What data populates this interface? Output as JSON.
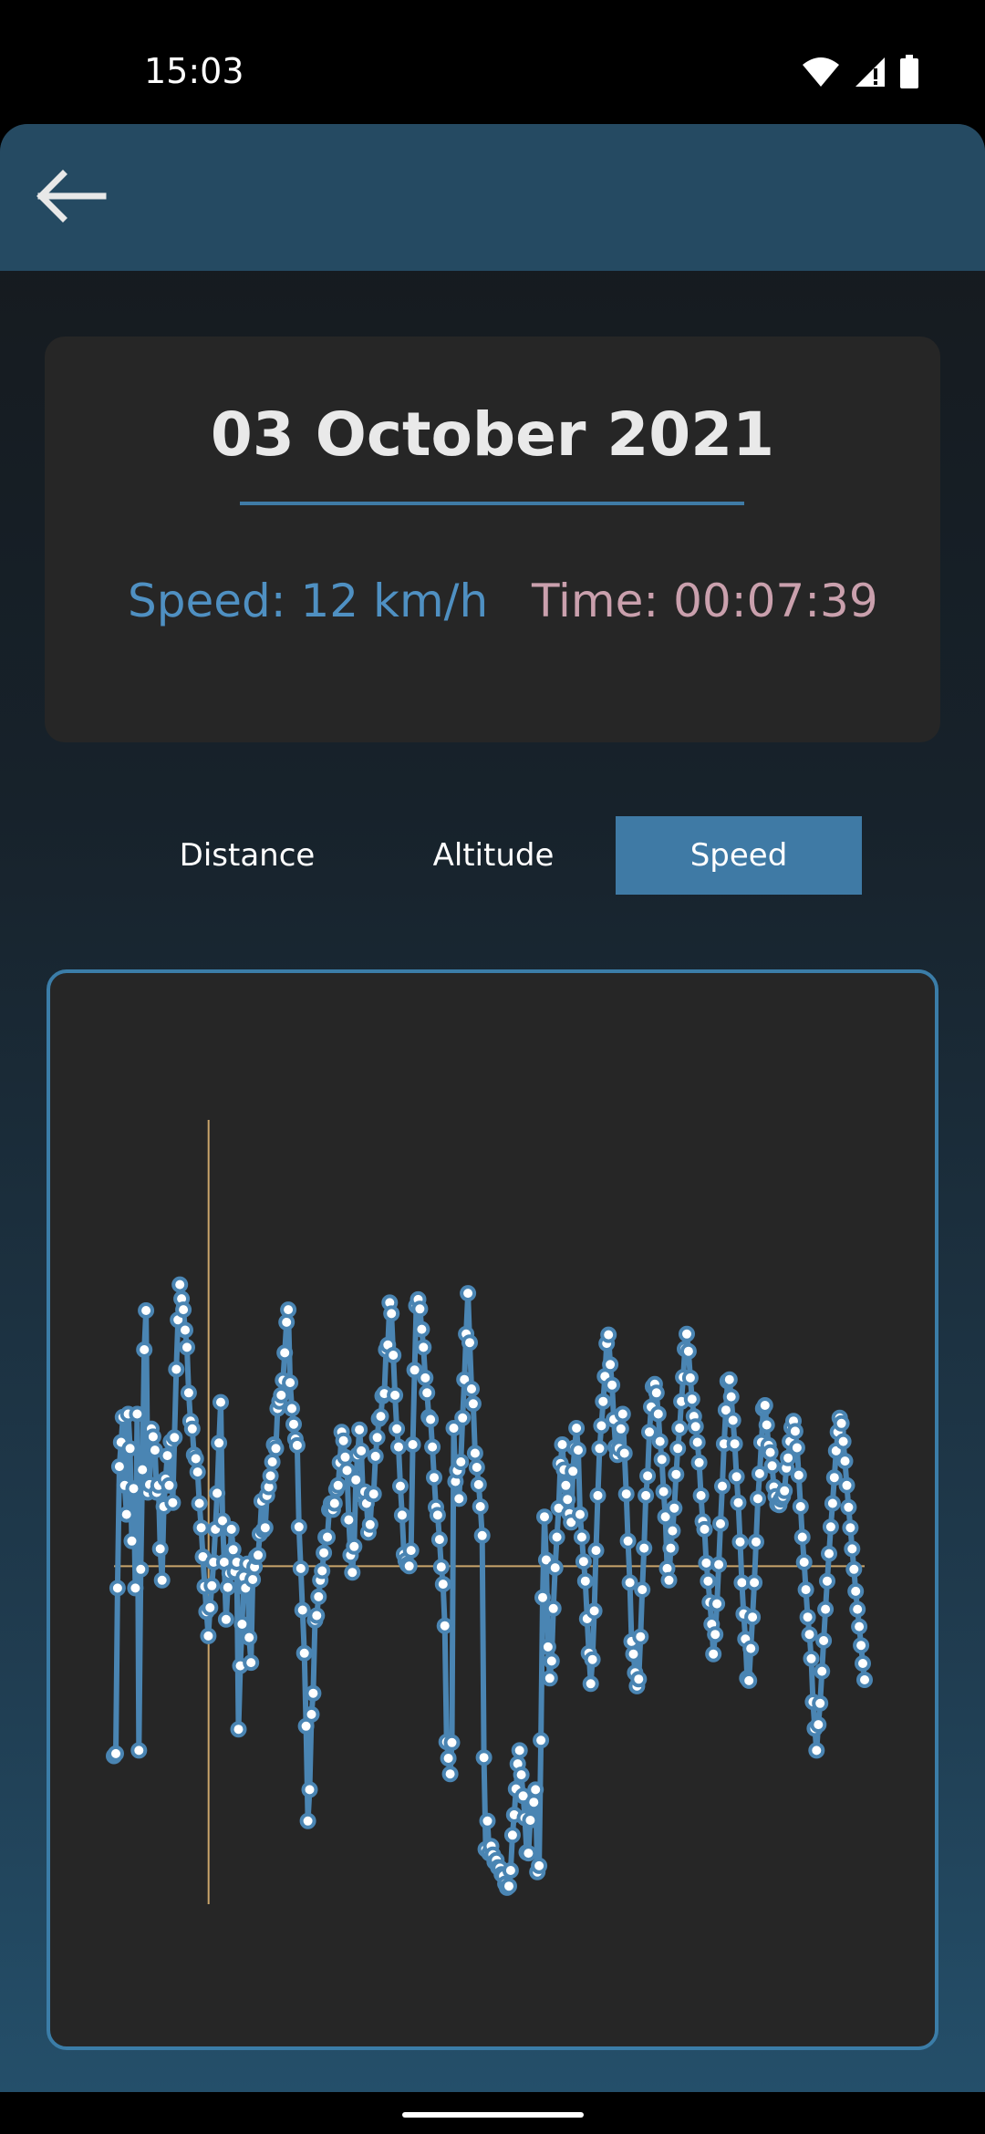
{
  "status_bar": {
    "time": "15:03",
    "icons": [
      "wifi-icon",
      "cell-signal-icon",
      "battery-icon"
    ]
  },
  "app_bar": {
    "back_icon": "arrow-back-icon"
  },
  "summary": {
    "date": "03 October 2021",
    "speed": "Speed: 12 km/h",
    "time": "Time: 00:07:39"
  },
  "tabs": [
    {
      "label": "Distance",
      "selected": false
    },
    {
      "label": "Altitude",
      "selected": false
    },
    {
      "label": "Speed",
      "selected": true
    }
  ],
  "colors": {
    "accent": "#3f7aa5",
    "line": "#4a85b3",
    "speed_text": "#4f90c2",
    "time_text": "#caa0ad",
    "crosshair": "#c9a56b"
  },
  "chart_data": {
    "type": "line",
    "title": "",
    "xlabel": "",
    "ylabel": "",
    "x_range": [
      0,
      100
    ],
    "y_range": [
      0,
      100
    ],
    "axes_visible": false,
    "grid": false,
    "crosshair": {
      "x": 12.6,
      "y": 43.1
    },
    "series": [
      {
        "y": [
          18.9,
          19.2,
          40.3,
          55.8,
          58.9,
          62.1,
          53.4,
          49.7,
          62.5,
          58.1,
          46.3,
          53.0,
          40.3,
          62.5,
          19.6,
          42.7,
          55.4,
          70.7,
          75.7,
          52.5,
          53.5,
          60.6,
          59.6,
          57.9,
          52.5,
          53.4,
          45.3,
          41.3,
          50.7,
          54.2,
          57.2,
          53.4,
          59.0,
          51.2,
          59.5,
          68.2,
          74.5,
          79.0,
          77.2,
          75.8,
          73.2,
          71.0,
          65.2,
          61.6,
          60.6,
          57.3,
          56.8,
          55.1,
          51.1,
          48.0,
          44.3,
          40.5,
          37.3,
          34.2,
          37.8,
          40.6,
          43.6,
          47.8,
          52.4,
          58.8,
          64.0,
          48.9,
          43.6,
          36.3,
          40.4,
          42.2,
          47.8,
          45.2,
          42.4,
          43.6,
          22.3,
          30.4,
          35.7,
          41.7,
          40.3,
          43.4,
          34.0,
          30.8,
          41.4,
          43.0,
          44.3,
          44.5,
          47.2,
          51.4,
          47.7,
          48.0,
          52.1,
          53.2,
          54.6,
          56.4,
          58.6,
          58.1,
          63.2,
          64.1,
          64.9,
          66.8,
          70.3,
          74.2,
          75.8,
          66.5,
          63.2,
          61.2,
          59.3,
          58.5,
          48.1,
          42.8,
          37.5,
          32.0,
          22.7,
          10.6,
          14.6,
          24.2,
          26.9,
          36.2,
          36.8,
          39.2,
          41.3,
          42.5,
          44.8,
          46.8,
          46.8,
          50.3,
          51.1,
          50.3,
          51.1,
          52.9,
          53.4,
          56.3,
          60.2,
          59.1,
          57.0,
          55.3,
          49.0,
          44.5,
          42.3,
          45.6,
          54.1,
          57.3,
          60.5,
          57.8,
          52.1,
          52.6,
          51.1,
          47.4,
          48.4,
          52.3,
          52.3,
          57.1,
          59.5,
          61.9,
          62.2,
          64.8,
          65.1,
          70.7,
          71.3,
          76.7,
          75.3,
          70.0,
          64.9,
          60.6,
          58.3,
          53.3,
          49.6,
          44.6,
          43.8,
          43.3,
          43.1,
          45.1,
          58.6,
          68.1,
          76.3,
          77.1,
          75.9,
          73.3,
          71.0,
          67.1,
          65.2,
          62.1,
          61.8,
          58.3,
          54.4,
          50.6,
          49.6,
          46.5,
          43.0,
          40.8,
          35.5,
          20.7,
          18.6,
          16.6,
          20.6,
          60.7,
          53.9,
          55.3,
          51.7,
          56.4,
          62.0,
          66.9,
          72.7,
          77.9,
          71.6,
          65.7,
          63.8,
          57.5,
          55.7,
          53.5,
          50.7,
          47.0,
          18.7,
          7.0,
          10.6,
          6.5,
          7.4,
          6.3,
          5.4,
          5.6,
          4.7,
          4.6,
          3.8,
          3.6,
          2.6,
          2.1,
          2.3,
          4.3,
          8.8,
          11.4,
          14.7,
          17.9,
          19.6,
          16.5,
          13.8,
          11.0,
          6.6,
          6.5,
          10.7,
          12.6,
          13.0,
          14.6,
          4.1,
          4.9,
          20.9,
          39.1,
          49.4,
          43.9,
          32.8,
          28.8,
          31.0,
          37.7,
          42.9,
          46.8,
          50.5,
          56.2,
          58.6,
          55.4,
          53.4,
          51.6,
          49.8,
          48.7,
          55.2,
          58.2,
          60.7,
          57.9,
          49.7,
          46.8,
          43.7,
          41.2,
          36.4,
          32.0,
          28.1,
          31.2,
          37.4,
          45.1,
          52.1,
          58.1,
          61.0,
          64.1,
          67.3,
          71.5,
          72.6,
          68.8,
          66.2,
          61.8,
          58.3,
          57.3,
          58.1,
          60.6,
          62.5,
          57.5,
          52.3,
          46.3,
          41.0,
          33.5,
          31.9,
          29.5,
          27.8,
          28.7,
          34.1,
          40.1,
          45.4,
          52.1,
          54.6,
          60.2,
          63.4,
          66.0,
          66.3,
          65.2,
          62.5,
          59.0,
          56.7,
          52.6,
          49.4,
          42.8,
          41.3,
          45.4,
          47.6,
          50.5,
          54.8,
          58.1,
          60.7,
          64.1,
          67.2,
          70.8,
          72.7,
          70.5,
          67.1,
          64.4,
          62.2,
          60.9,
          58.9,
          56.3,
          52.1,
          48.8,
          47.8,
          43.5,
          41.2,
          38.5,
          35.7,
          31.9,
          34.4,
          38.3,
          43.3,
          48.5,
          53.3,
          58.7,
          63.0,
          66.7,
          66.9,
          64.7,
          61.7,
          58.7,
          54.5,
          51.2,
          46.2,
          41.0,
          37.0,
          33.8,
          28.8,
          28.5,
          32.6,
          36.6,
          41.0,
          46.2,
          51.7,
          54.9,
          58.9,
          63.2,
          63.6,
          61.1,
          58.5,
          57.6,
          55.9,
          53.2,
          52.0,
          51.0,
          50.9,
          51.6,
          52.0,
          52.7,
          55.6,
          56.9,
          59.0,
          60.8,
          61.6,
          60.3,
          58.2,
          54.7,
          50.7,
          46.8,
          43.6,
          40.1,
          36.6,
          34.4,
          31.3,
          25.8,
          22.4,
          19.6,
          22.9,
          25.6,
          29.7,
          33.6,
          37.6,
          41.2,
          44.7,
          48.1,
          51.1,
          54.4,
          57.8,
          60.2,
          62.0,
          61.3,
          59.0,
          56.5,
          53.4,
          50.6,
          48.0,
          45.3,
          42.7,
          39.9,
          37.6,
          35.4,
          33.0,
          30.7,
          28.6
        ]
      }
    ]
  }
}
